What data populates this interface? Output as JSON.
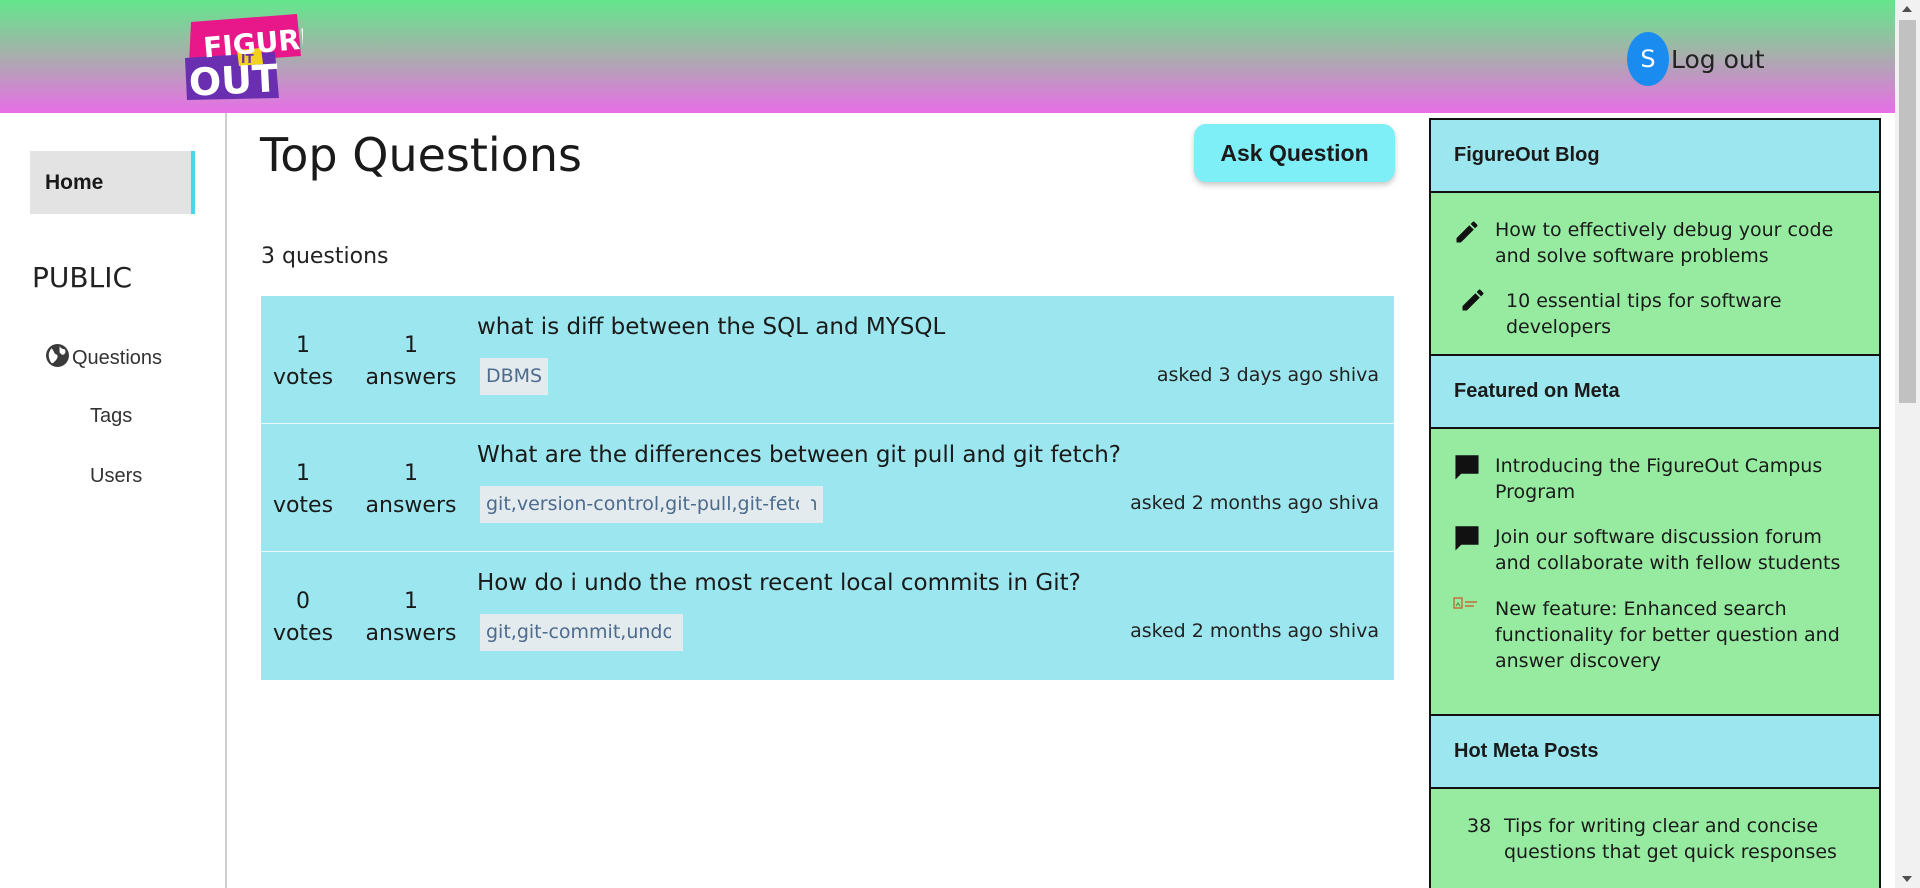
{
  "header": {
    "logo": {
      "line1": "FIGURE",
      "line2": "IT",
      "line3": "OUT"
    },
    "avatar_initial": "S",
    "logout_label": "Log out"
  },
  "sidebar": {
    "home_label": "Home",
    "section_label": "PUBLIC",
    "items": [
      {
        "label": "Questions",
        "icon": "globe-icon"
      },
      {
        "label": "Tags"
      },
      {
        "label": "Users"
      }
    ],
    "active_color": "#4ed3ec"
  },
  "main": {
    "title": "Top Questions",
    "ask_button_label": "Ask Question",
    "question_count": "3 questions",
    "questions": [
      {
        "votes": "1",
        "votes_label": "votes",
        "answers": "1",
        "answers_label": "answers",
        "title": "what is diff between the SQL and MYSQL",
        "tags": "DBMS",
        "meta": "asked 3 days ago shiva"
      },
      {
        "votes": "1",
        "votes_label": "votes",
        "answers": "1",
        "answers_label": "answers",
        "title": "What are the differences between git pull and git fetch?",
        "tags": "git,version-control,git-pull,git-fetch",
        "meta": "asked 2 months ago shiva"
      },
      {
        "votes": "0",
        "votes_label": "votes",
        "answers": "1",
        "answers_label": "answers",
        "title": "How do i undo the most recent local commits in Git?",
        "tags": "git,git-commit,undo",
        "meta": "asked 2 months ago shiva"
      }
    ]
  },
  "right_panel": {
    "blog": {
      "title": "FigureOut Blog",
      "items": [
        {
          "text": "How to effectively debug your code and solve software problems",
          "icon": "pencil-icon"
        },
        {
          "text": "10 essential tips for software developers",
          "icon": "pencil-icon"
        }
      ]
    },
    "meta": {
      "title": "Featured on Meta",
      "items": [
        {
          "text": "Introducing the FigureOut Campus Program",
          "icon": "comment-icon"
        },
        {
          "text": "Join our software discussion forum and collaborate with fellow students",
          "icon": "comment-icon"
        },
        {
          "text": "New feature: Enhanced search functionality for better question and answer discovery",
          "icon": "broken-image-icon"
        }
      ]
    },
    "hot": {
      "title": "Hot Meta Posts",
      "items": [
        {
          "count": "38",
          "text": "Tips for writing clear and concise questions that get quick responses"
        }
      ]
    }
  },
  "colors": {
    "header_top": "#63e68c",
    "header_bottom": "#e86ee6",
    "question_bg": "#9ce7ef",
    "panel_green": "#96eba0",
    "ask_button": "#7eeef7",
    "avatar": "#1a8cf0"
  }
}
